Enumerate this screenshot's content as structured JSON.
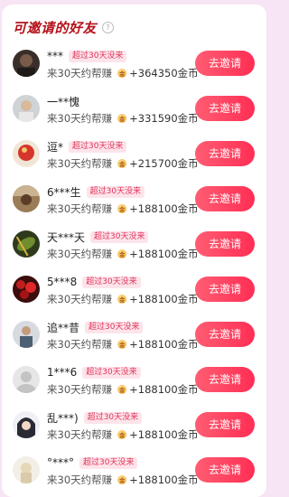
{
  "header": {
    "title": "可邀请的好友",
    "help_icon": "?"
  },
  "rows": [
    {
      "name": "***",
      "tag": "超过30天没来",
      "sub": "来30天约帮赚",
      "reward": "+364350金币",
      "button": "去邀请",
      "avatar": "dark-portrait"
    },
    {
      "name": "一**愧",
      "tag": "",
      "sub": "来30天约帮赚",
      "reward": "+331590金币",
      "button": "去邀请",
      "avatar": "man-portrait"
    },
    {
      "name": "逗*",
      "tag": "超过30天没来",
      "sub": "来30天约帮赚",
      "reward": "+215700金币",
      "button": "去邀请",
      "avatar": "red-figure"
    },
    {
      "name": "6***生",
      "tag": "超过30天没来",
      "sub": "来30天约帮赚",
      "reward": "+188100金币",
      "button": "去邀请",
      "avatar": "outdoor-photo"
    },
    {
      "name": "天***天",
      "tag": "超过30天没来",
      "sub": "来30天约帮赚",
      "reward": "+188100金币",
      "button": "去邀请",
      "avatar": "green-leaf"
    },
    {
      "name": "5***8",
      "tag": "超过30天没来",
      "sub": "来30天约帮赚",
      "reward": "+188100金币",
      "button": "去邀请",
      "avatar": "red-flowers"
    },
    {
      "name": "追**昔",
      "tag": "超过30天没来",
      "sub": "来30天约帮赚",
      "reward": "+188100金币",
      "button": "去邀请",
      "avatar": "person-photo"
    },
    {
      "name": "1***6",
      "tag": "超过30天没来",
      "sub": "来30天约帮赚",
      "reward": "+188100金币",
      "button": "去邀请",
      "avatar": "default-avatar"
    },
    {
      "name": "乱***)",
      "tag": "超过30天没来",
      "sub": "来30天约帮赚",
      "reward": "+188100金币",
      "button": "去邀请",
      "avatar": "anime-portrait"
    },
    {
      "name": "°***°",
      "tag": "超过30天没来",
      "sub": "来30天约帮赚",
      "reward": "+188100金币",
      "button": "去邀请",
      "avatar": "pale-figure"
    }
  ],
  "colors": {
    "accent": "#ff3f5f",
    "title": "#b5121b",
    "tag_bg": "#fde4ea",
    "background": "#f7e4f4"
  }
}
